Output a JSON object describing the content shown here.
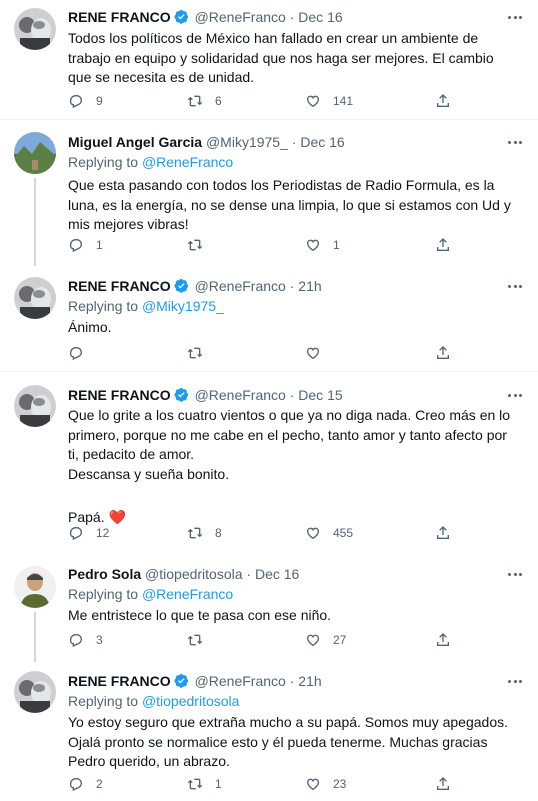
{
  "tweets": [
    {
      "name": "RENE FRANCO",
      "handle": "@ReneFranco",
      "sep": "·",
      "date": "Dec 16",
      "verified": true,
      "replying_prefix": "",
      "replying_to": "",
      "lines": [
        "Todos los políticos de México han fallado en crear un ambiente de trabajo en equipo y solidaridad que nos haga ser mejores. El cambio que se necesita es de unidad."
      ],
      "replies": "9",
      "retweets": "6",
      "likes": "141"
    },
    {
      "name": "Miguel Angel Garcia",
      "handle": "@Miky1975_",
      "sep": "·",
      "date": "Dec 16",
      "verified": false,
      "replying_prefix": "Replying to",
      "replying_to": "@ReneFranco",
      "lines": [
        "Que esta pasando con todos los Periodistas de Radio Formula, es la luna, es la energía, no se dense una limpia, lo que si estamos con Ud y mis mejores vibras!"
      ],
      "replies": "1",
      "retweets": "",
      "likes": "1"
    },
    {
      "name": "RENE FRANCO",
      "handle": "@ReneFranco",
      "sep": "·",
      "date": "21h",
      "verified": true,
      "replying_prefix": "Replying to",
      "replying_to": "@Miky1975_",
      "lines": [
        "Ánimo."
      ],
      "replies": "",
      "retweets": "",
      "likes": ""
    },
    {
      "name": "RENE FRANCO",
      "handle": "@ReneFranco",
      "sep": "·",
      "date": "Dec 15",
      "verified": true,
      "replying_prefix": "",
      "replying_to": "",
      "lines": [
        "Que lo grite a los cuatro vientos o que ya no diga nada. Creo más en lo primero, porque no me cabe en el pecho, tanto amor y tanto afecto por ti, pedacito de amor.",
        "Descansa y sueña bonito.",
        "",
        "Papá. ❤️"
      ],
      "replies": "12",
      "retweets": "8",
      "likes": "455"
    },
    {
      "name": "Pedro Sola",
      "handle": "@tiopedritosola",
      "sep": "·",
      "date": "Dec 16",
      "verified": false,
      "replying_prefix": "Replying to",
      "replying_to": "@ReneFranco",
      "lines": [
        "Me entristece lo que te pasa con ese niño."
      ],
      "replies": "3",
      "retweets": "",
      "likes": "27"
    },
    {
      "name": "RENE FRANCO",
      "handle": "@ReneFranco",
      "sep": "·",
      "date": "21h",
      "verified": true,
      "replying_prefix": "Replying to",
      "replying_to": "@tiopedritosola",
      "lines": [
        "Yo estoy seguro que extraña mucho a su papá. Somos muy apegados. Ojalá pronto se normalice esto y él pueda tenerme. Muchas gracias Pedro querido, un abrazo."
      ],
      "replies": "2",
      "retweets": "1",
      "likes": "23"
    }
  ],
  "colors": {
    "accent": "#1d9bf0",
    "muted": "#536471",
    "heart": "#f91880"
  },
  "icons": [
    "reply-icon",
    "retweet-icon",
    "like-icon",
    "share-icon",
    "verified-icon",
    "more-icon"
  ]
}
